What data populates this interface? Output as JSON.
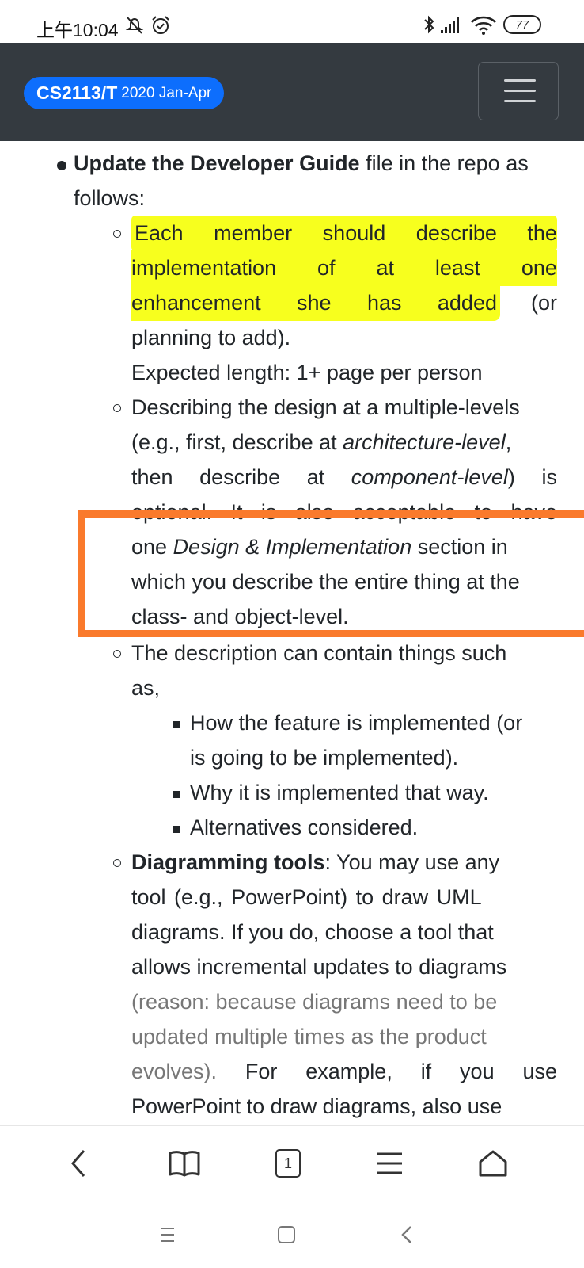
{
  "status_bar": {
    "time": "上午10:04",
    "battery": "77",
    "icons": [
      "alarm-off-icon",
      "alarm-icon",
      "bluetooth-icon",
      "signal-icon",
      "wifi-icon",
      "battery-icon"
    ]
  },
  "navbar": {
    "brand_code": "CS2113/T",
    "brand_term": "2020 Jan-Apr",
    "menu_icon": "hamburger-menu-icon",
    "colors": {
      "background": "#343a40",
      "brand": "#0d6efd"
    }
  },
  "content": {
    "item1": {
      "bold": "Update the Developer Guide",
      "rest": " file in the repo as",
      "line2": "follows:"
    },
    "sub1": {
      "l1": [
        "Each",
        "member",
        "should",
        "describe",
        "the"
      ],
      "l2": [
        "implementation",
        "of",
        "at",
        "least",
        "one"
      ],
      "l3": [
        "enhancement",
        "she",
        "has",
        "added"
      ],
      "l3_tail": "(or",
      "l4": "planning to add).",
      "l5": "Expected length: 1+ page per person"
    },
    "sub2": {
      "l1": "Describing the design at a multiple-levels",
      "l2_a": "(e.g., first, describe at ",
      "l2_em": "architecture-level",
      "l2_b": ",",
      "l3_a": "then",
      "l3_b": "describe",
      "l3_c": "at",
      "l3_em": "component-level",
      "l3_d": ")",
      "l3_e": "is",
      "l4": [
        "optional.",
        "It",
        "is",
        "also",
        "acceptable",
        "to",
        "have"
      ],
      "l5_a": "one ",
      "l5_em": "Design & Implementation",
      "l5_b": " section in",
      "l6": "which you describe the entire thing at the",
      "l7": "class- and object-level."
    },
    "sub3": {
      "l1": "The description can contain things such",
      "l2": "as,",
      "items": [
        {
          "l1": "How the feature is implemented (or",
          "l2": "is going to be implemented)."
        },
        {
          "l1": "Why it is implemented that way."
        },
        {
          "l1": "Alternatives considered."
        }
      ]
    },
    "sub4": {
      "bold": "Diagramming tools",
      "l1_rest": ": You may use any",
      "l2": "tool (e.g., PowerPoint) to draw UML",
      "l3": "diagrams. If you do, choose a tool that",
      "l4": "allows incremental updates to diagrams",
      "l5": "(reason: because diagrams need to be",
      "l6": "updated multiple times as the product",
      "l7_grey": "evolves).",
      "l7_rest": [
        "For",
        "example,",
        "if",
        "you",
        "use"
      ],
      "l8": "PowerPoint to draw diagrams, also use"
    },
    "highlight_color": "#f7ff1e",
    "annotation_color": "#fa7a2c"
  },
  "bottom_bar": {
    "tab_count": "1",
    "icons": [
      "back-icon",
      "bookmarks-icon",
      "tabs-icon",
      "menu-icon",
      "home-icon"
    ]
  },
  "system_nav": {
    "icons": [
      "recents-icon",
      "home-button-icon",
      "back-nav-icon"
    ]
  }
}
